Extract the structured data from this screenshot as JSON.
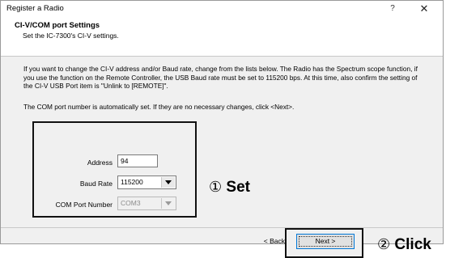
{
  "window": {
    "title": "Register a Radio",
    "help_label": "?",
    "close_label": "✕"
  },
  "header": {
    "title": "CI-V/COM port Settings",
    "subtitle": "Set the IC-7300's CI-V settings."
  },
  "body": {
    "paragraph1": "If you want to change the CI-V address and/or Baud rate, change from the lists below. The Radio has the Spectrum scope function, if you use the function on the Remote Controller, the USB Baud rate must be set to 115200 bps. At this time, also confirm the setting of the CI-V USB Port item is \"Unlink to [REMOTE]\".",
    "paragraph2": "The COM port number is automatically set. If they are no necessary changes, click <Next>."
  },
  "form": {
    "address_label": "Address",
    "address_value": "94",
    "baud_label": "Baud Rate",
    "baud_value": "115200",
    "com_label": "COM Port Number",
    "com_value": "COM3"
  },
  "callouts": {
    "set_num": "①",
    "set_label": "Set",
    "click_num": "②",
    "click_label": "Click"
  },
  "footer": {
    "back_label": "< Back",
    "next_label": "Next >"
  },
  "colors": {
    "dialog_bg": "#f0f0f0",
    "focus_border": "#0078d7"
  }
}
